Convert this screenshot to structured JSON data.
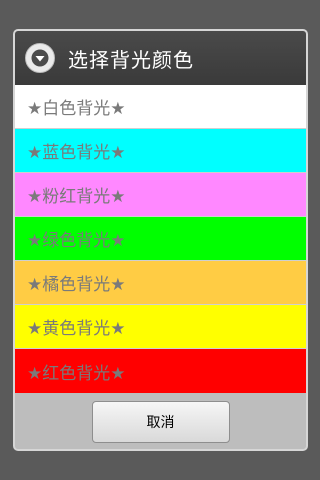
{
  "dialog": {
    "title": "选择背光颜色",
    "title_icon": "dropdown-circle-icon",
    "items": [
      {
        "label": "★白色背光★",
        "color": "#ffffff"
      },
      {
        "label": "★蓝色背光★",
        "color": "#00ffff"
      },
      {
        "label": "★粉红背光★",
        "color": "#ff88ff"
      },
      {
        "label": "★绿色背光★",
        "color": "#00ff00"
      },
      {
        "label": "★橘色背光★",
        "color": "#ffcc44"
      },
      {
        "label": "★黄色背光★",
        "color": "#ffff00"
      },
      {
        "label": "★红色背光★",
        "color": "#ff0000"
      }
    ],
    "cancel_label": "取消"
  }
}
